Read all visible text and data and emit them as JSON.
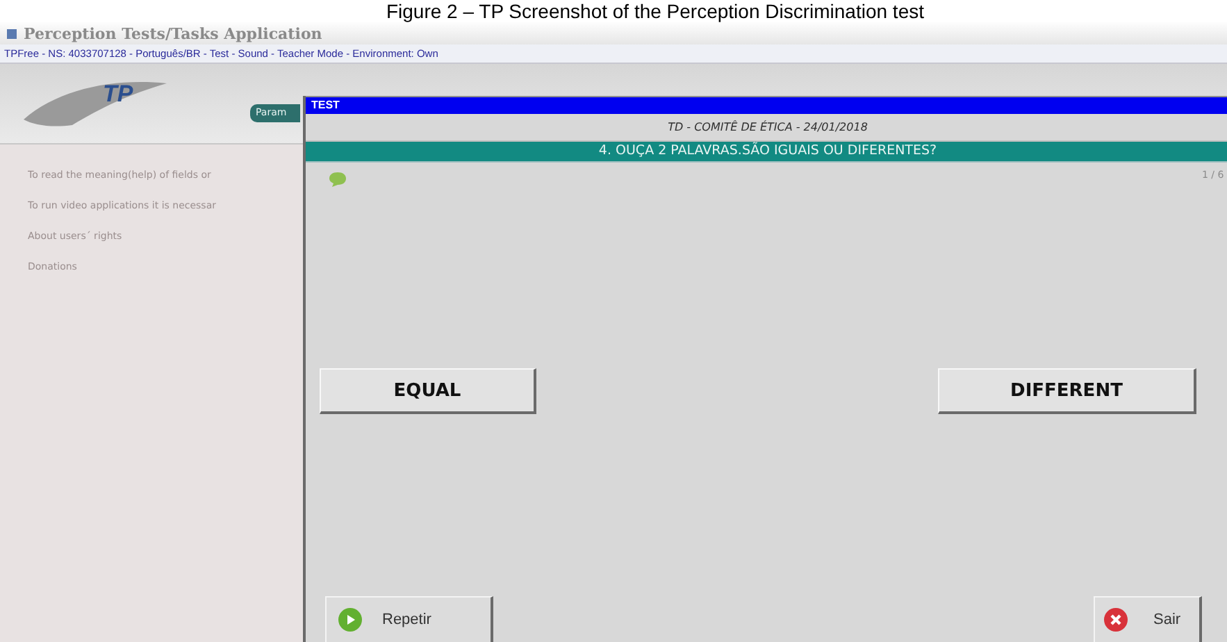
{
  "caption": "Figure 2 – TP Screenshot of the Perception Discrimination test",
  "window": {
    "title": "Perception Tests/Tasks Application"
  },
  "info_bar": "TPFree - NS: 4033707128 - Português/BR - Test - Sound - Teacher Mode - Environment: Own",
  "header": {
    "logo": "TP",
    "tab": "Param"
  },
  "sidebar": {
    "items": [
      "To read the meaning(help) of fields or",
      "To run video applications it is necessar",
      "About users´ rights",
      "Donations"
    ]
  },
  "dialog": {
    "title": "TEST",
    "subtitle": "TD - COMITÊ DE ÉTICA - 24/01/2018",
    "question": "4. OUÇA 2 PALAVRAS.SÃO IGUAIS OU DIFERENTES?",
    "counter": "1 / 6",
    "answers": [
      "EQUAL",
      "DIFFERENT"
    ],
    "actions": [
      {
        "kind": "play",
        "label": "Repetir"
      },
      {
        "kind": "close",
        "label": "Sair"
      }
    ]
  }
}
